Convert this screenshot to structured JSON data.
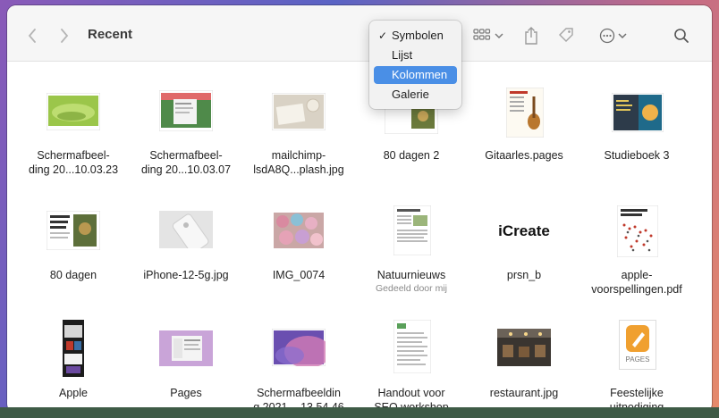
{
  "toolbar": {
    "title": "Recent"
  },
  "view_menu": {
    "items": [
      {
        "label": "Symbolen",
        "checked": true
      },
      {
        "label": "Lijst"
      },
      {
        "label": "Kolommen",
        "highlighted": true
      },
      {
        "label": "Galerie"
      }
    ],
    "check_glyph": "✓"
  },
  "files": [
    {
      "label_1": "Schermafbeel-",
      "label_2": "ding 20...10.03.23"
    },
    {
      "label_1": "Schermafbeel-",
      "label_2": "ding 20...10.03.07"
    },
    {
      "label_1": "mailchimp-",
      "label_2": "lsdA8Q...plash.jpg"
    },
    {
      "label_1": "80 dagen 2"
    },
    {
      "label_1": "Gitaarles.pages"
    },
    {
      "label_1": "Studieboek 3"
    },
    {
      "label_1": "80 dagen"
    },
    {
      "label_1": "iPhone-12-5g.jpg"
    },
    {
      "label_1": "IMG_0074"
    },
    {
      "label_1": "Natuurnieuws",
      "sublabel": "Gedeeld door mij"
    },
    {
      "label_1": "prsn_b",
      "thumb_text": "iCreate"
    },
    {
      "label_1": "apple-",
      "label_2": "voorspellingen.pdf"
    },
    {
      "label_1": "Apple"
    },
    {
      "label_1": "Pages"
    },
    {
      "label_1": "Schermafbeeldin",
      "label_2": "g 2021-...13.54.46"
    },
    {
      "label_1": "Handout voor",
      "label_2": "SEO workshop"
    },
    {
      "label_1": "restaurant.jpg"
    },
    {
      "label_1": "Feestelijke",
      "label_2": "uitnodiging",
      "thumb_text": "PAGES"
    }
  ],
  "colors": {
    "accent": "#4a8fe6",
    "toolbar_bg": "#f6f6f6",
    "icon": "#8a8a8a"
  }
}
